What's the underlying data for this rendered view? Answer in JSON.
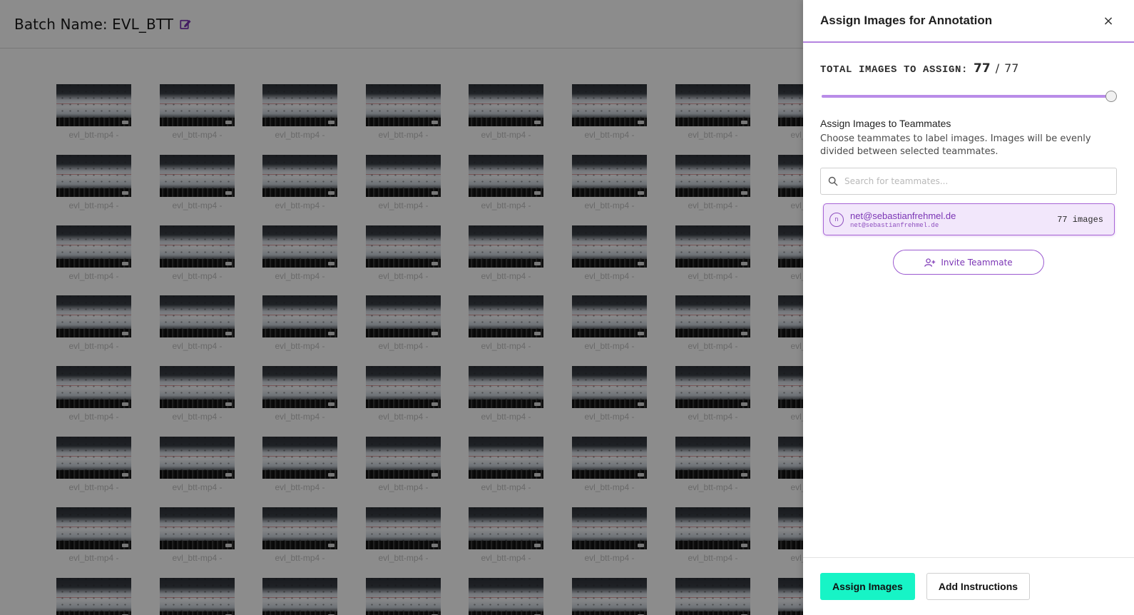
{
  "page": {
    "batch_label": "Batch Name: EVL_BTT",
    "edit_icon": "edit-icon",
    "thumbnail_label": "evl_btt-mp4 -"
  },
  "drawer": {
    "title": "Assign Images for Annotation",
    "close_icon": "×",
    "total_label": "TOTAL IMAGES TO ASSIGN:",
    "total_count": "77",
    "total_separator": "/",
    "total_max": "77",
    "slider_fraction": 1.0,
    "section_title": "Assign Images to Teammates",
    "section_description": "Choose teammates to label images. Images will be evenly divided between selected teammates.",
    "search_placeholder": "Search for teammates...",
    "teammate": {
      "avatar_letter": "n",
      "name": "net@sebastianfrehmel.de",
      "email": "net@sebastianfrehmel.de",
      "count": "77 images"
    },
    "invite_label": "Invite Teammate",
    "assign_button": "Assign Images",
    "instructions_button": "Add Instructions"
  },
  "colors": {
    "accent_purple": "#9b59d0",
    "primary_button": "#17f4c6",
    "overlay": "rgba(0,0,0,0.45)"
  }
}
